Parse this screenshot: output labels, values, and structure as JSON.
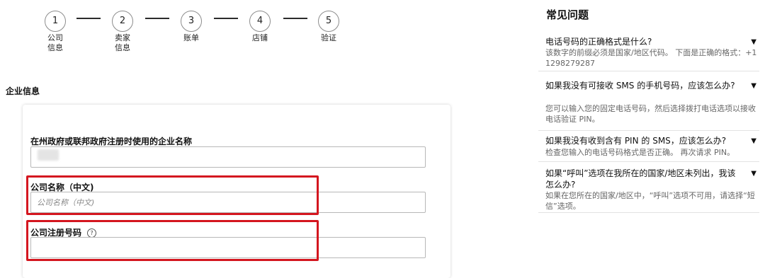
{
  "stepper": {
    "steps": [
      {
        "number": "1",
        "label": "公司\n信息"
      },
      {
        "number": "2",
        "label": "卖家\n信息"
      },
      {
        "number": "3",
        "label": "账单"
      },
      {
        "number": "4",
        "label": "店铺"
      },
      {
        "number": "5",
        "label": "验证"
      }
    ]
  },
  "section_title": "企业信息",
  "form": {
    "registered_name": {
      "label": "在州政府或联邦政府注册时使用的企业名称",
      "value": ""
    },
    "company_name_cn": {
      "label": "公司名称（中文)",
      "placeholder": "公司名称（中文)",
      "value": ""
    },
    "registration_number": {
      "label": "公司注册号码",
      "help_icon": "question-circle-icon",
      "value": ""
    }
  },
  "faq": {
    "title": "常见问题",
    "items": [
      {
        "question": "电话号码的正确格式是什么?",
        "answer": "该数字的前缀必须是国家/地区代码。 下面是正确的格式：+1 1298279287"
      },
      {
        "question": "如果我没有可接收 SMS 的手机号码，应该怎么办?",
        "answer": "您可以输入您的固定电话号码，然后选择拨打电话选项以接收电话验证 PIN。"
      },
      {
        "question": "如果我没有收到含有 PIN 的 SMS，应该怎么办?",
        "answer": "检查您输入的电话号码格式是否正确。 再次请求 PIN。"
      },
      {
        "question": "如果“呼叫”选项在我所在的国家/地区未列出，我该怎么办?",
        "answer": "如果在您所在的国家/地区中，“呼叫”选项不可用，请选择“短信”选项。"
      }
    ],
    "arrow_icon": "caret-down-icon"
  },
  "colors": {
    "highlight": "#d4161f",
    "step_border": "#8c8c8c"
  }
}
